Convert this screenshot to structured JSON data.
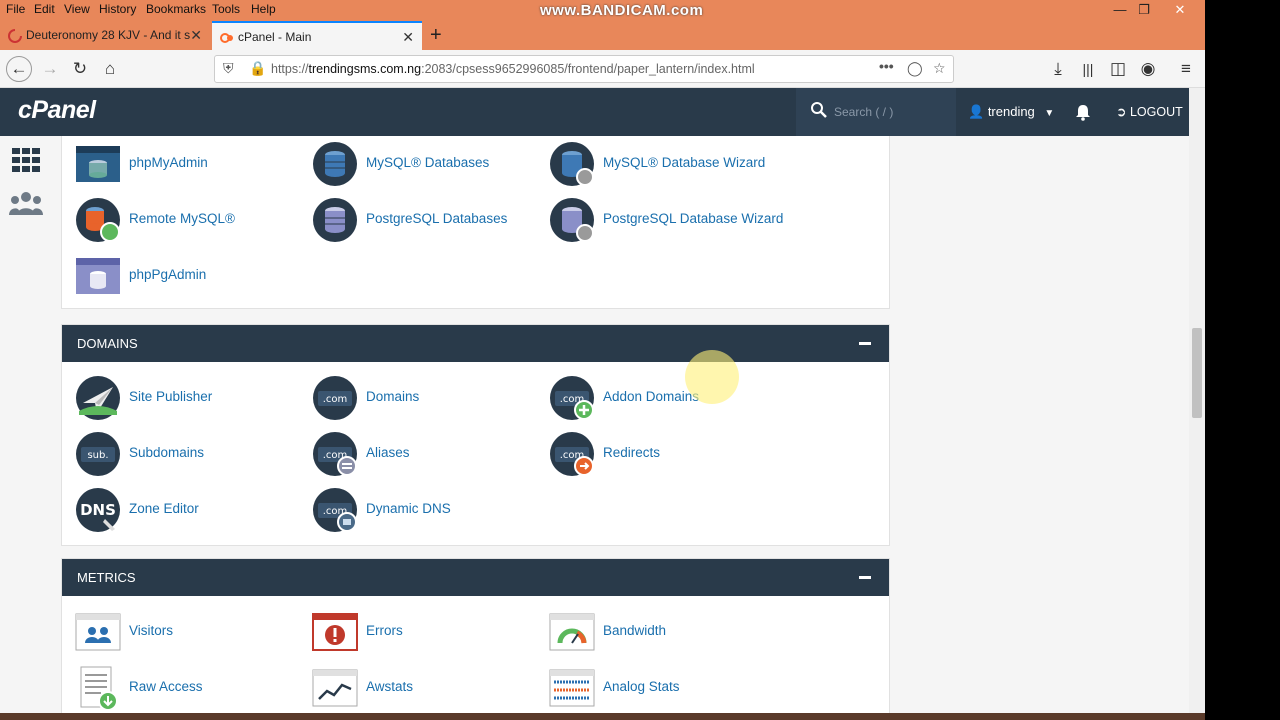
{
  "browser": {
    "menu": [
      "File",
      "Edit",
      "View",
      "History",
      "Bookmarks",
      "Tools",
      "Help"
    ],
    "watermark": "www.BANDICAM.com",
    "tabs": [
      {
        "title": "Deuteronomy 28 KJV - And it s"
      },
      {
        "title": "cPanel - Main"
      }
    ],
    "url_prefix": "https://",
    "url_host": "trendingsms.com.ng",
    "url_rest": ":2083/cpsess9652996085/frontend/paper_lantern/index.html"
  },
  "header": {
    "logo": "cPanel",
    "search_placeholder": "Search ( / )",
    "user": "trending",
    "logout": "LOGOUT"
  },
  "databases": {
    "items": [
      {
        "label": "phpMyAdmin",
        "icon": "phpmyadmin-icon"
      },
      {
        "label": "MySQL® Databases",
        "icon": "mysql-databases-icon"
      },
      {
        "label": "MySQL® Database Wizard",
        "icon": "mysql-wizard-icon"
      },
      {
        "label": "Remote MySQL®",
        "icon": "remote-mysql-icon"
      },
      {
        "label": "PostgreSQL Databases",
        "icon": "postgresql-databases-icon"
      },
      {
        "label": "PostgreSQL Database Wizard",
        "icon": "postgresql-wizard-icon"
      },
      {
        "label": "phpPgAdmin",
        "icon": "phppgadmin-icon"
      }
    ]
  },
  "domains": {
    "title": "DOMAINS",
    "items": [
      {
        "label": "Site Publisher",
        "icon": "site-publisher-icon"
      },
      {
        "label": "Domains",
        "icon": "domains-icon"
      },
      {
        "label": "Addon Domains",
        "icon": "addon-domains-icon"
      },
      {
        "label": "Subdomains",
        "icon": "subdomains-icon"
      },
      {
        "label": "Aliases",
        "icon": "aliases-icon"
      },
      {
        "label": "Redirects",
        "icon": "redirects-icon"
      },
      {
        "label": "Zone Editor",
        "icon": "zone-editor-icon"
      },
      {
        "label": "Dynamic DNS",
        "icon": "dynamic-dns-icon"
      }
    ]
  },
  "metrics": {
    "title": "METRICS",
    "items": [
      {
        "label": "Visitors",
        "icon": "visitors-icon"
      },
      {
        "label": "Errors",
        "icon": "errors-icon"
      },
      {
        "label": "Bandwidth",
        "icon": "bandwidth-icon"
      },
      {
        "label": "Raw Access",
        "icon": "raw-access-icon"
      },
      {
        "label": "Awstats",
        "icon": "awstats-icon"
      },
      {
        "label": "Analog Stats",
        "icon": "analog-stats-icon"
      }
    ]
  },
  "icon_text": {
    "com": ".com",
    "sub": "sub.",
    "dns": "DNS"
  },
  "colors": {
    "browser_chrome": "#e8875a",
    "cpanel_navy": "#293a4a",
    "link_blue": "#1a6fad"
  }
}
